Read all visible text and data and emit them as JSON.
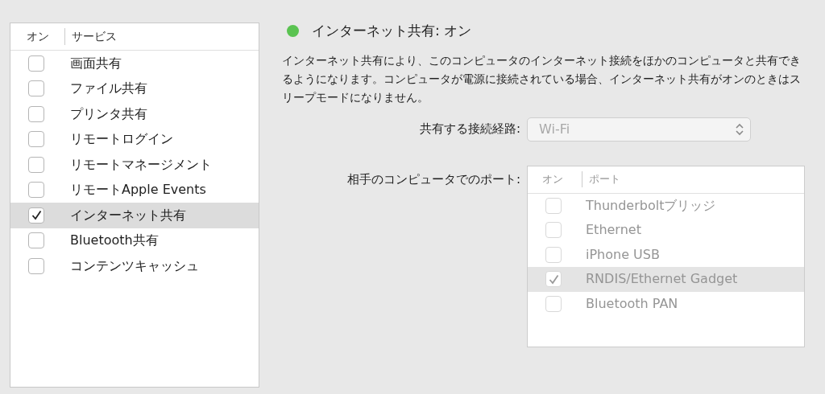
{
  "services": {
    "columns": [
      "オン",
      "サービス"
    ],
    "items": [
      {
        "label": "画面共有",
        "checked": false,
        "selected": false
      },
      {
        "label": "ファイル共有",
        "checked": false,
        "selected": false
      },
      {
        "label": "プリンタ共有",
        "checked": false,
        "selected": false
      },
      {
        "label": "リモートログイン",
        "checked": false,
        "selected": false
      },
      {
        "label": "リモートマネージメント",
        "checked": false,
        "selected": false
      },
      {
        "label": "リモートApple Events",
        "checked": false,
        "selected": false
      },
      {
        "label": "インターネット共有",
        "checked": true,
        "selected": true
      },
      {
        "label": "Bluetooth共有",
        "checked": false,
        "selected": false
      },
      {
        "label": "コンテンツキャッシュ",
        "checked": false,
        "selected": false
      }
    ]
  },
  "status": {
    "color": "#5ac351",
    "title": "インターネット共有: オン"
  },
  "description": "インターネット共有により、このコンピュータのインターネット接続をほかのコンピュータと共有できるようになります。コンピュータが電源に接続されている場合、インターネット共有がオンのときはスリープモードになりません。",
  "share_from": {
    "label": "共有する接続経路:",
    "value": "Wi-Fi",
    "disabled": true
  },
  "ports": {
    "label": "相手のコンピュータでのポート:",
    "disabled": true,
    "columns": [
      "オン",
      "ポート"
    ],
    "items": [
      {
        "label": "Thunderboltブリッジ",
        "checked": false,
        "selected": false
      },
      {
        "label": "Ethernet",
        "checked": false,
        "selected": false
      },
      {
        "label": "iPhone USB",
        "checked": false,
        "selected": false
      },
      {
        "label": "RNDIS/Ethernet Gadget",
        "checked": true,
        "selected": true
      },
      {
        "label": "Bluetooth PAN",
        "checked": false,
        "selected": false
      }
    ]
  }
}
